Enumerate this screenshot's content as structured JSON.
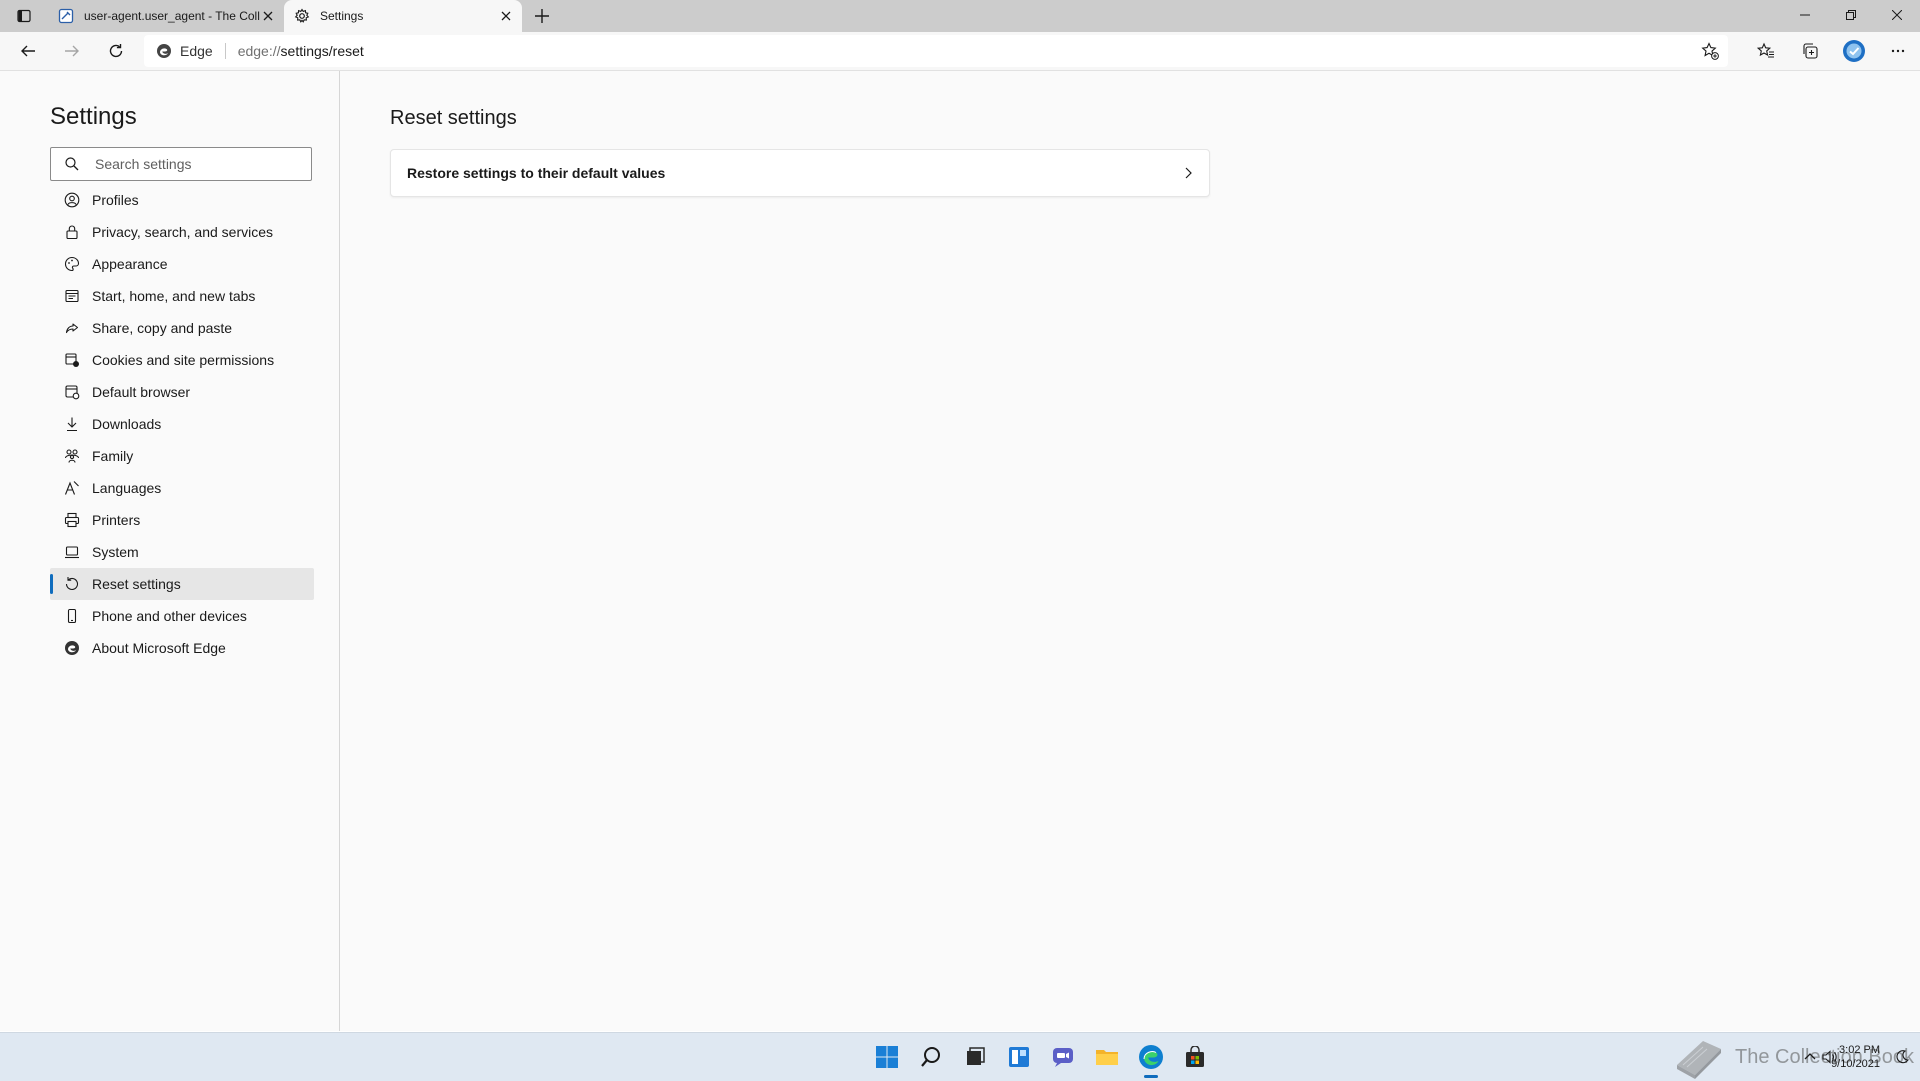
{
  "browser": {
    "tabs": [
      {
        "title": "user-agent.user_agent - The Coll",
        "icon": "document-icon",
        "active": false
      },
      {
        "title": "Settings",
        "icon": "gear-icon",
        "active": true
      }
    ],
    "address": {
      "site_label": "Edge",
      "url_prefix": "edge://",
      "url_path": "settings/reset"
    }
  },
  "settings": {
    "title": "Settings",
    "search_placeholder": "Search settings",
    "nav": [
      {
        "label": "Profiles",
        "icon": "profile-icon"
      },
      {
        "label": "Privacy, search, and services",
        "icon": "lock-icon"
      },
      {
        "label": "Appearance",
        "icon": "palette-icon"
      },
      {
        "label": "Start, home, and new tabs",
        "icon": "home-tabs-icon"
      },
      {
        "label": "Share, copy and paste",
        "icon": "share-icon"
      },
      {
        "label": "Cookies and site permissions",
        "icon": "cookies-icon"
      },
      {
        "label": "Default browser",
        "icon": "browser-icon"
      },
      {
        "label": "Downloads",
        "icon": "download-icon"
      },
      {
        "label": "Family",
        "icon": "family-icon"
      },
      {
        "label": "Languages",
        "icon": "languages-icon"
      },
      {
        "label": "Printers",
        "icon": "printer-icon"
      },
      {
        "label": "System",
        "icon": "laptop-icon"
      },
      {
        "label": "Reset settings",
        "icon": "reset-icon",
        "selected": true
      },
      {
        "label": "Phone and other devices",
        "icon": "phone-icon"
      },
      {
        "label": "About Microsoft Edge",
        "icon": "edge-icon"
      }
    ]
  },
  "main": {
    "heading": "Reset settings",
    "card_label": "Restore settings to their default values"
  },
  "taskbar": {
    "watermark": "The Collection Book",
    "time": "3:02 PM",
    "date": "9/10/2021"
  },
  "colors": {
    "accent": "#0f6cbd",
    "tabstrip": "#cccccc",
    "taskbar": "#dfe8f2"
  }
}
